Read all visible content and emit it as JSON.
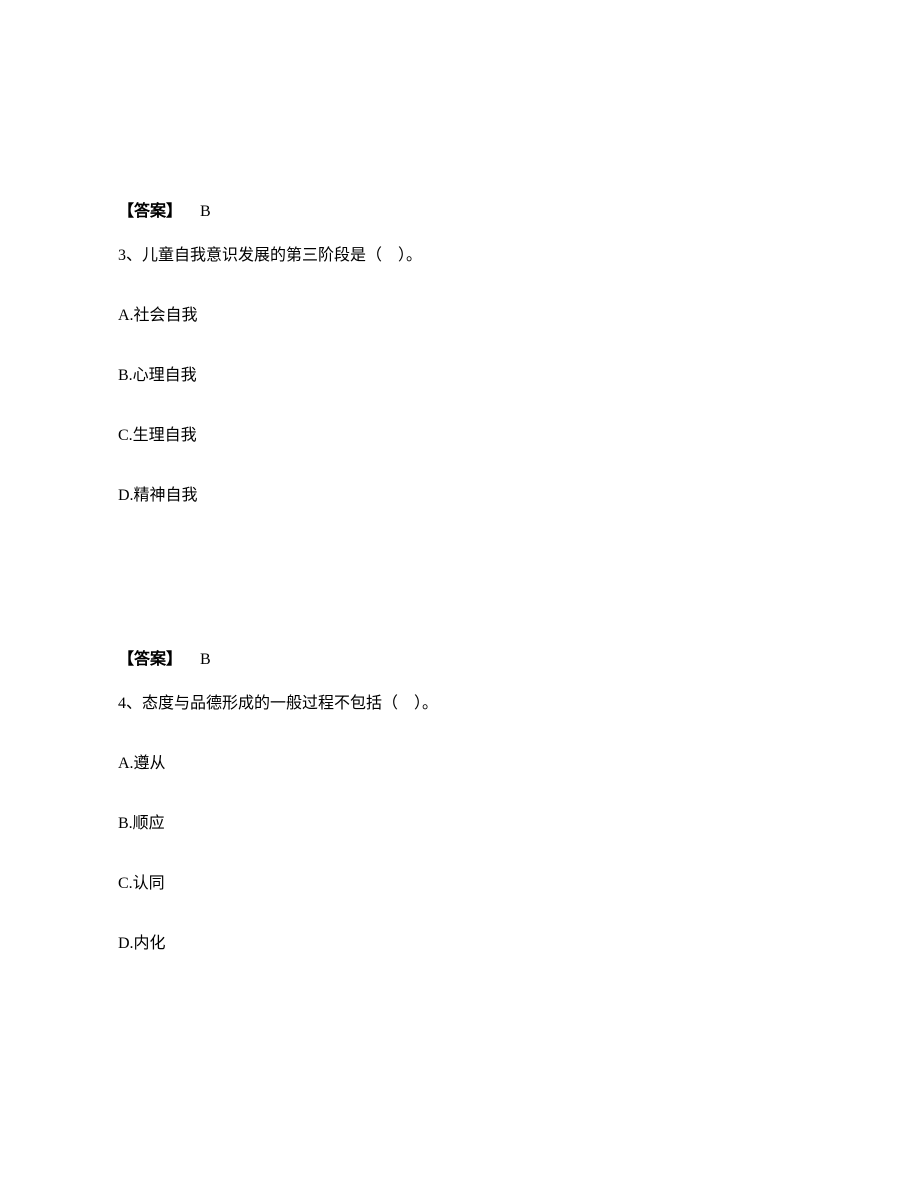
{
  "q3": {
    "answer_label": "【答案】",
    "answer_value": "B",
    "question": "3、儿童自我意识发展的第三阶段是（　）。",
    "options": {
      "a": "A.社会自我",
      "b": "B.心理自我",
      "c": "C.生理自我",
      "d": "D.精神自我"
    }
  },
  "q4": {
    "answer_label": "【答案】",
    "answer_value": "B",
    "question": "4、态度与品德形成的一般过程不包括（　）。",
    "options": {
      "a": "A.遵从",
      "b": "B.顺应",
      "c": "C.认同",
      "d": "D.内化"
    }
  }
}
